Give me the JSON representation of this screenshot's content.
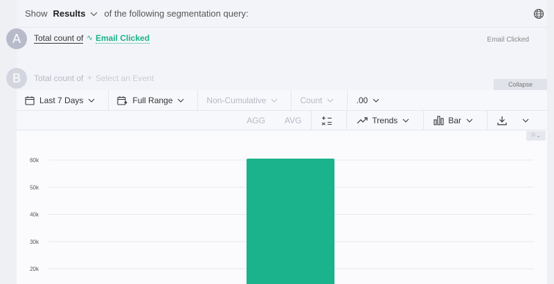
{
  "header": {
    "show_label": "Show",
    "results_label": "Results",
    "query_suffix": "of the following segmentation query:"
  },
  "queries": [
    {
      "badge": "A",
      "total_label": "Total count of",
      "event_label": "Email Clicked",
      "right_label": "Email Clicked"
    },
    {
      "badge": "B",
      "total_label": "Total count of",
      "event_placeholder": "Select an Event"
    }
  ],
  "collapse_label": "Collapse",
  "controls": {
    "date_range": "Last 7 Days",
    "range": "Full Range",
    "cumulative": "Non-Cumulative",
    "measure": "Count",
    "decimals": ".00"
  },
  "controls2": {
    "agg": "AGG",
    "avg": "AVG",
    "trends": "Trends",
    "chart_type": "Bar"
  },
  "colors": {
    "accent": "#19b38a",
    "bar": "#1ab38b"
  },
  "chart_data": {
    "type": "bar",
    "y_ticks": [
      "60k",
      "50k",
      "40k",
      "30k",
      "20k"
    ],
    "tick_values": [
      60000,
      50000,
      40000,
      30000,
      20000
    ],
    "categories": [
      ""
    ],
    "values": [
      60500
    ],
    "ylim": [
      20000,
      60000
    ],
    "grid": true
  }
}
